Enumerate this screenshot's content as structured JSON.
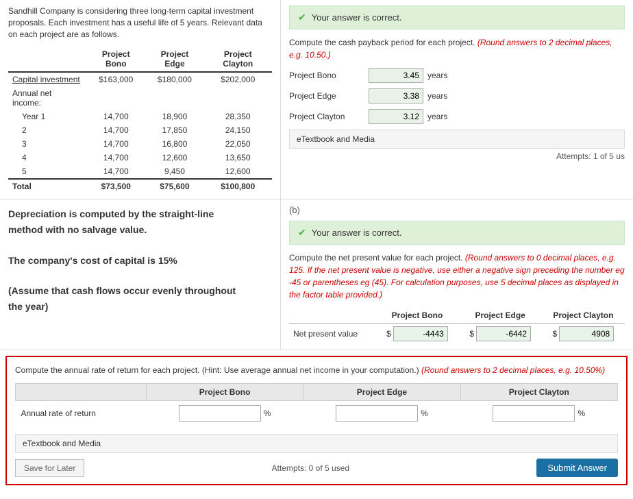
{
  "intro": {
    "text": "Sandhill Company is considering three long-term capital investment proposals. Each investment has a useful life of 5 years. Relevant data on each project are as follows."
  },
  "table": {
    "headers": [
      "",
      "Project Bono",
      "Project Edge",
      "Project Clayton"
    ],
    "capital_row": [
      "Capital investment",
      "$163,000",
      "$180,000",
      "$202,000"
    ],
    "annual_label": "Annual net income:",
    "years": [
      {
        "year": "Year  1",
        "bono": "14,700",
        "edge": "18,900",
        "clayton": "28,350"
      },
      {
        "year": "2",
        "bono": "14,700",
        "edge": "17,850",
        "clayton": "24,150"
      },
      {
        "year": "3",
        "bono": "14,700",
        "edge": "16,800",
        "clayton": "22,050"
      },
      {
        "year": "4",
        "bono": "14,700",
        "edge": "12,600",
        "clayton": "13,650"
      },
      {
        "year": "5",
        "bono": "14,700",
        "edge": "9,450",
        "clayton": "12,600"
      }
    ],
    "total_row": [
      "Total",
      "$73,500",
      "$75,600",
      "$100,800"
    ]
  },
  "depreciation_note": "Depreciation is computed by the straight-line method with no salvage value. The company's cost of capital is 15% (Assume that cash flows occur evenly throughout the year.)",
  "bold_lines": [
    "Depreciation is computed by the straight-line",
    "method with no salvage value.",
    "The company's cost of capital is 15%",
    "(Assume that cash flows occur evenly throughout",
    "the year)"
  ],
  "part_a": {
    "correct_text": "Your answer is correct.",
    "instruction": "Compute the cash payback period for each project.",
    "instruction_red": "(Round answers to 2 decimal places, e.g. 10.50.)",
    "rows": [
      {
        "label": "Project Bono",
        "value": "3.45",
        "unit": "years"
      },
      {
        "label": "Project Edge",
        "value": "3.38",
        "unit": "years"
      },
      {
        "label": "Project Clayton",
        "value": "3.12",
        "unit": "years"
      }
    ],
    "etextbook": "eTextbook and Media",
    "attempts": "Attempts: 1 of 5 us"
  },
  "section_b_label": "(b)",
  "part_b": {
    "correct_text": "Your answer is correct.",
    "instruction": "Compute the net present value for each project.",
    "instruction_red": "(Round answers to 0 decimal places, e.g. 125. If the net present value is negative, use either a negative sign preceding the number eg -45 or parentheses eg (45). For calculation purposes, use 5 decimal places as displayed in the factor table provided.)",
    "headers": [
      "",
      "Project Bono",
      "Project Edge",
      "Project Clayton"
    ],
    "npv_row": {
      "label": "Net present value",
      "bono_dollar": "$",
      "bono_value": "-4443",
      "edge_dollar": "$",
      "edge_value": "-6442",
      "clayton_dollar": "$",
      "clayton_value": "4908"
    }
  },
  "part_c": {
    "instruction": "Compute the annual rate of return for each project.",
    "hint": "(Hint: Use average annual net income in your computation.)",
    "instruction_red": "(Round answers to 2 decimal places, e.g. 10.50%)",
    "headers": [
      "",
      "Project Bono",
      "Project Edge",
      "Project Clayton"
    ],
    "row_label": "Annual rate of return",
    "bono_value": "",
    "edge_value": "",
    "clayton_value": "",
    "pct": "%",
    "etextbook": "eTextbook and Media",
    "attempts_text": "Attempts: 0 of 5 used",
    "save_label": "Save for Later",
    "submit_label": "Submit Answer"
  }
}
